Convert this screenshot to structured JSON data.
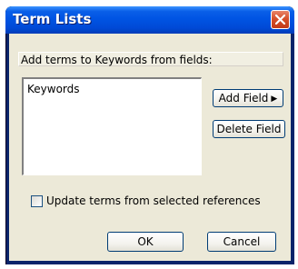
{
  "window": {
    "title": "Term Lists"
  },
  "section": {
    "label": "Add terms to Keywords from fields:"
  },
  "fields_list": {
    "items": [
      "Keywords"
    ]
  },
  "buttons": {
    "add_field": "Add Field",
    "delete_field": "Delete Field",
    "ok": "OK",
    "cancel": "Cancel"
  },
  "update_option": {
    "label": "Update terms from selected references",
    "checked": false
  },
  "icons": {
    "close": "close-icon",
    "add_field_arrow": "triangle-right-icon"
  },
  "colors": {
    "titlebar": "#0054e3",
    "close_button": "#d6502a",
    "dialog_background": "#ece9d8"
  }
}
